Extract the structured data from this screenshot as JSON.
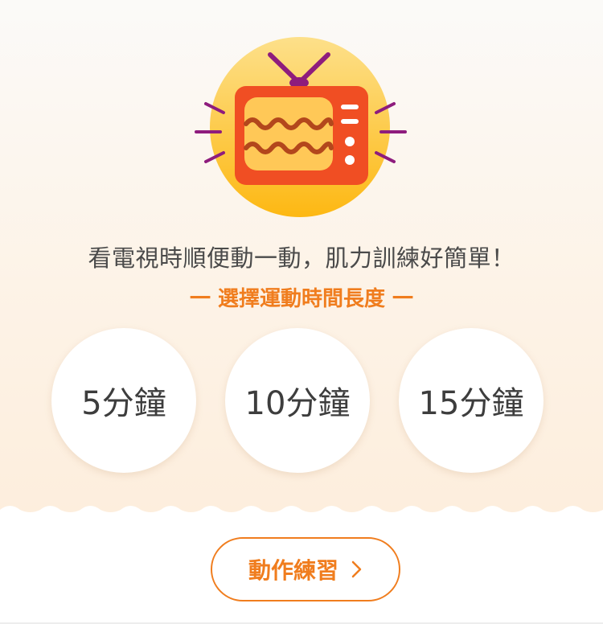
{
  "hero": {
    "illustration_icon": "tv-icon",
    "headline": "看電視時順便動一動，肌力訓練好簡單！",
    "subheadline": "一 選擇運動時間長度 一"
  },
  "duration_options": [
    {
      "label": "5分鐘"
    },
    {
      "label": "10分鐘"
    },
    {
      "label": "15分鐘"
    }
  ],
  "practice_button": {
    "label": "動作練習",
    "icon": "chevron-right-icon"
  },
  "colors": {
    "accent": "#f07d1e",
    "tv_body": "#f04e23",
    "tv_screen": "#ffc857",
    "tv_waves": "#b3471c",
    "antenna": "#8e1c7d",
    "sun_top": "#fde08a",
    "sun_bottom": "#fdb813",
    "hero_bg": "#fdf3e7"
  }
}
